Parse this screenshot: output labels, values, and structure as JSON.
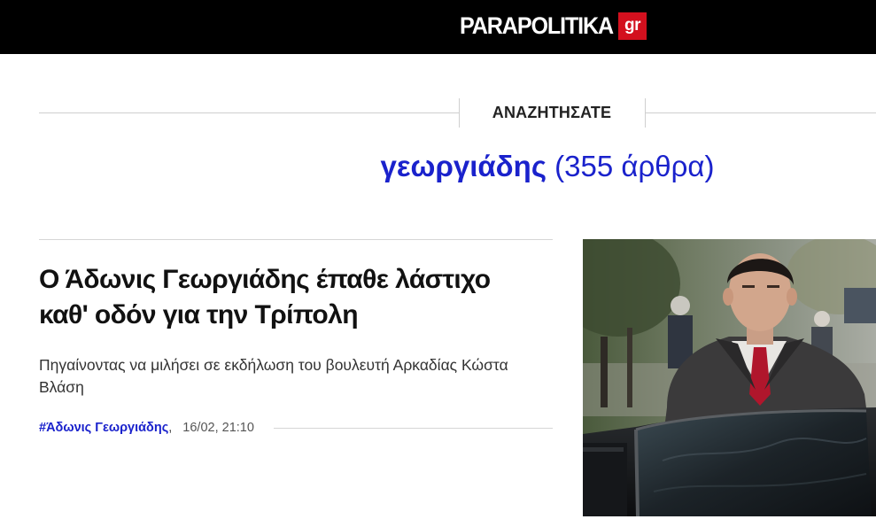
{
  "header": {
    "logo_text": "PARAPOLITIKA",
    "logo_badge": "gr",
    "logo_badge_color": "#d3101e",
    "background_color": "#000000"
  },
  "search": {
    "label": "ΑΝΑΖΗΤΗΣΑΤΕ",
    "query": "γεωργιάδης",
    "count_text": "(355 άρθρα)",
    "accent_color": "#1a22cc"
  },
  "articles": [
    {
      "title": "Ο Άδωνις Γεωργιάδης έπαθε λάστιχο καθ' οδόν για την Τρίπολη",
      "subtitle": "Πηγαίνοντας να μιλήσει σε εκδήλωση του βουλευτή Αρκαδίας Κώστα Βλάση",
      "tag": "#Άδωνις Γεωργιάδης",
      "separator": ",",
      "datetime": "16/02, 21:10",
      "image": "photo-man-in-suit-at-car-door"
    }
  ]
}
